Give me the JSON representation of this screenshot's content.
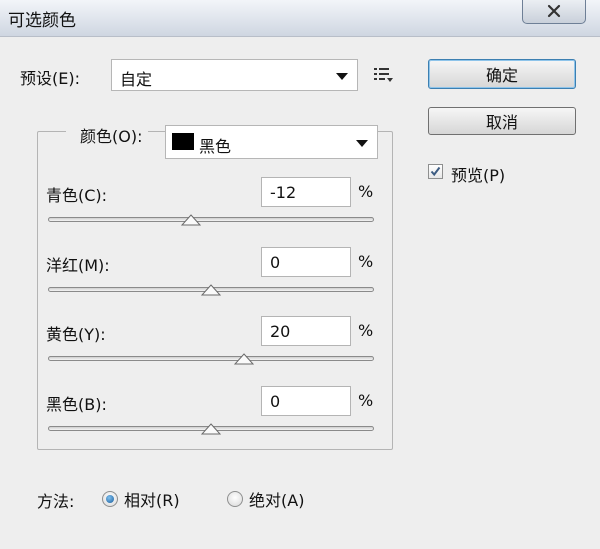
{
  "window": {
    "title": "可选颜色"
  },
  "preset": {
    "label": "预设(E):",
    "value": "自定"
  },
  "buttons": {
    "ok": "确定",
    "cancel": "取消"
  },
  "preview": {
    "label": "预览(P)",
    "checked": true
  },
  "color_select": {
    "label": "颜色(O):",
    "value": "黑色",
    "swatch": "#000000"
  },
  "sliders": [
    {
      "label": "青色(C):",
      "value": "-12",
      "unit": "%",
      "level": -12
    },
    {
      "label": "洋红(M):",
      "value": "0",
      "unit": "%",
      "level": 0
    },
    {
      "label": "黄色(Y):",
      "value": "20",
      "unit": "%",
      "level": 20
    },
    {
      "label": "黑色(B):",
      "value": "0",
      "unit": "%",
      "level": 0
    }
  ],
  "method": {
    "label": "方法:",
    "options": [
      {
        "label": "相对(R)",
        "selected": true
      },
      {
        "label": "绝对(A)",
        "selected": false
      }
    ]
  }
}
